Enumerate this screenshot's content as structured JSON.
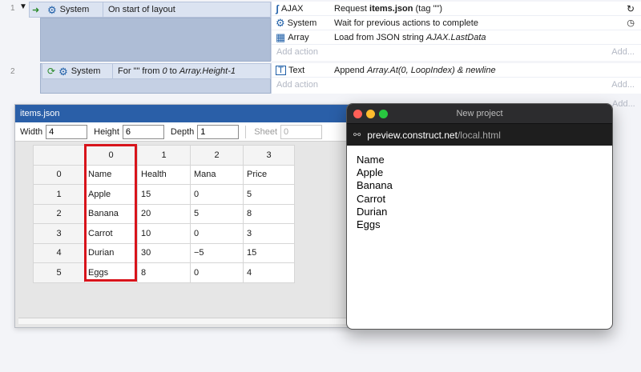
{
  "event1": {
    "number": "1",
    "condition": {
      "object": "System",
      "text": "On start of layout"
    },
    "actions": [
      {
        "icon": "ajax-icon",
        "object": "AJAX",
        "text_pre": "Request ",
        "text_bold": "items.json",
        "text_post": " (tag \"\")"
      },
      {
        "icon": "gear-icon",
        "object": "System",
        "text_pre": "Wait for previous actions to complete",
        "text_bold": "",
        "text_post": ""
      },
      {
        "icon": "array-icon",
        "object": "Array",
        "text_pre": "Load from JSON string ",
        "text_italic": "AJAX.LastData"
      }
    ],
    "add_action": "Add action",
    "add_right": "Add..."
  },
  "event2": {
    "number": "2",
    "condition": {
      "object": "System",
      "text_pre": "For \"\" from ",
      "text_italic1": "0",
      "text_mid": " to ",
      "text_italic2": "Array.Height-1"
    },
    "actions": [
      {
        "icon": "text-icon",
        "object": "Text",
        "text_pre": "Append ",
        "text_italic": "Array.At(0, LoopIndex) & newline"
      }
    ],
    "add_action": "Add action",
    "add_right": "Add...",
    "add_right2": "Add..."
  },
  "array_editor": {
    "title": "items.json",
    "width_label": "Width",
    "width_value": "4",
    "height_label": "Height",
    "height_value": "6",
    "depth_label": "Depth",
    "depth_value": "1",
    "sheet_label": "Sheet",
    "sheet_value": "0",
    "columns": [
      "0",
      "1",
      "2",
      "3"
    ],
    "rows": [
      {
        "index": "0",
        "cells": [
          "Name",
          "Health",
          "Mana",
          "Price"
        ]
      },
      {
        "index": "1",
        "cells": [
          "Apple",
          "15",
          "0",
          "5"
        ]
      },
      {
        "index": "2",
        "cells": [
          "Banana",
          "20",
          "5",
          "8"
        ]
      },
      {
        "index": "3",
        "cells": [
          "Carrot",
          "10",
          "0",
          "3"
        ]
      },
      {
        "index": "4",
        "cells": [
          "Durian",
          "30",
          "−5",
          "15"
        ]
      },
      {
        "index": "5",
        "cells": [
          "Eggs",
          "8",
          "0",
          "4"
        ]
      }
    ],
    "highlight_color": "#d8141b"
  },
  "preview": {
    "title": "New project",
    "url_host": "preview.construct.net",
    "url_path": "/local.html",
    "lines": [
      "Name",
      "Apple",
      "Banana",
      "Carrot",
      "Durian",
      "Eggs"
    ],
    "traffic_colors": [
      "#ff5f57",
      "#febc2e",
      "#28c840"
    ]
  },
  "colors": {
    "condition_bg": "#dbe3f1",
    "title_bar": "#2a5fa8"
  }
}
